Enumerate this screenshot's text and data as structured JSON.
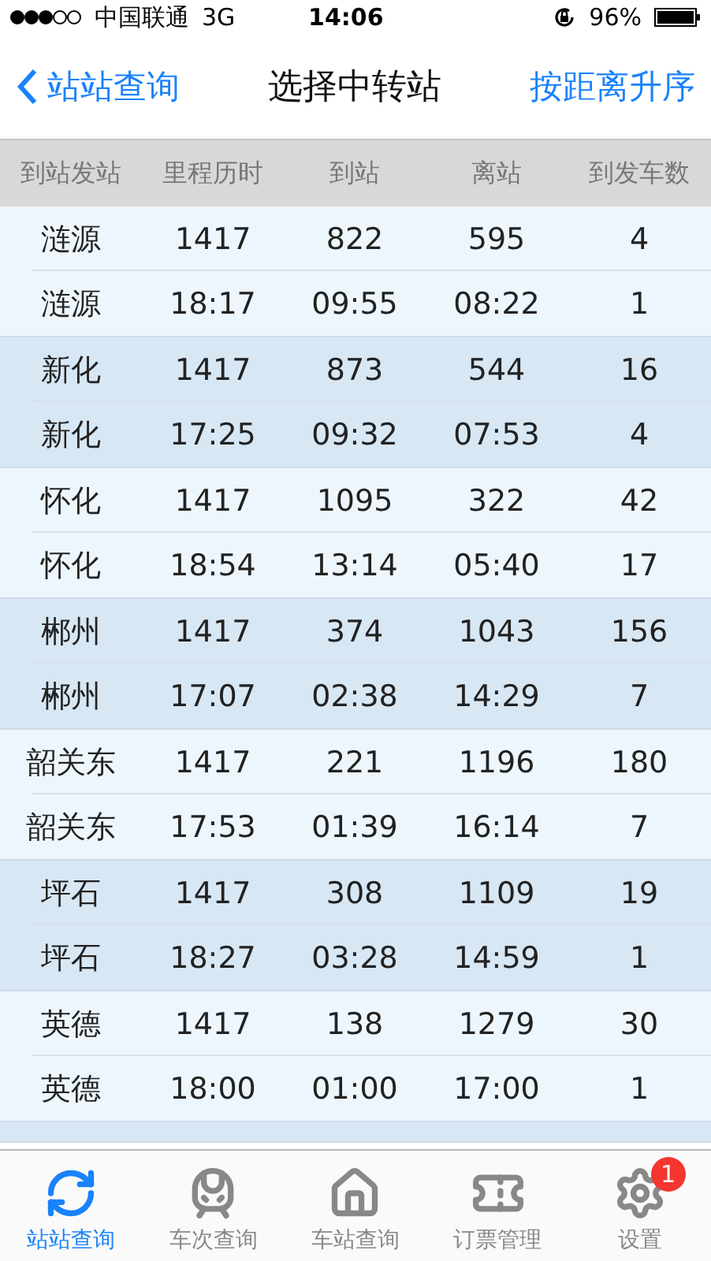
{
  "status_bar": {
    "carrier": "中国联通",
    "network": "3G",
    "time": "14:06",
    "battery": "96%"
  },
  "nav": {
    "back": "站站查询",
    "title": "选择中转站",
    "action": "按距离升序"
  },
  "table": {
    "columns": [
      "到站发站",
      "里程历时",
      "到站",
      "离站",
      "到发车数"
    ],
    "groups": [
      {
        "rows": [
          [
            "涟源",
            "1417",
            "822",
            "595",
            "4"
          ],
          [
            "涟源",
            "18:17",
            "09:55",
            "08:22",
            "1"
          ]
        ]
      },
      {
        "rows": [
          [
            "新化",
            "1417",
            "873",
            "544",
            "16"
          ],
          [
            "新化",
            "17:25",
            "09:32",
            "07:53",
            "4"
          ]
        ]
      },
      {
        "rows": [
          [
            "怀化",
            "1417",
            "1095",
            "322",
            "42"
          ],
          [
            "怀化",
            "18:54",
            "13:14",
            "05:40",
            "17"
          ]
        ]
      },
      {
        "rows": [
          [
            "郴州",
            "1417",
            "374",
            "1043",
            "156"
          ],
          [
            "郴州",
            "17:07",
            "02:38",
            "14:29",
            "7"
          ]
        ]
      },
      {
        "rows": [
          [
            "韶关东",
            "1417",
            "221",
            "1196",
            "180"
          ],
          [
            "韶关东",
            "17:53",
            "01:39",
            "16:14",
            "7"
          ]
        ]
      },
      {
        "rows": [
          [
            "坪石",
            "1417",
            "308",
            "1109",
            "19"
          ],
          [
            "坪石",
            "18:27",
            "03:28",
            "14:59",
            "1"
          ]
        ]
      },
      {
        "rows": [
          [
            "英德",
            "1417",
            "138",
            "1279",
            "30"
          ],
          [
            "英德",
            "18:00",
            "01:00",
            "17:00",
            "1"
          ]
        ]
      }
    ]
  },
  "tab_bar": [
    {
      "kind": "swap",
      "label": "站站查询",
      "selected": true
    },
    {
      "kind": "train",
      "label": "车次查询",
      "selected": false
    },
    {
      "kind": "house",
      "label": "车站查询",
      "selected": false
    },
    {
      "kind": "ticket",
      "label": "订票管理",
      "selected": false
    },
    {
      "kind": "gear",
      "label": "设置",
      "selected": false,
      "badge": "1"
    }
  ]
}
